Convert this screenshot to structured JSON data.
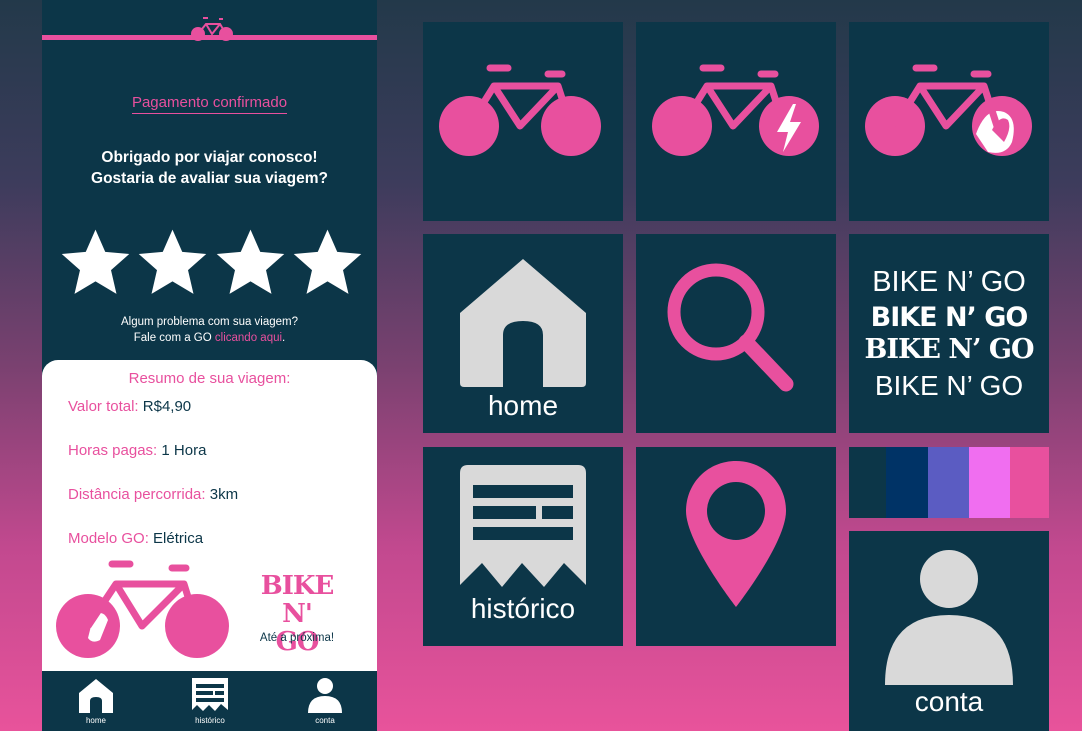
{
  "phone": {
    "payment_title": "Pagamento confirmado",
    "thanks_line1": "Obrigado por viajar conosco!",
    "thanks_line2": "Gostaria de avaliar sua viagem?",
    "rating": 4,
    "problem_line1": "Algum problema com sua viagem?",
    "problem_prefix": "Fale com a GO ",
    "problem_link": "clicando aqui",
    "problem_suffix": ".",
    "summary": {
      "title": "Resumo de sua viagem:",
      "rows": [
        {
          "label": "Valor total:",
          "value": "R$4,90"
        },
        {
          "label": "Horas pagas:",
          "value": "1 Hora"
        },
        {
          "label": "Distância percorrida:",
          "value": "3km"
        },
        {
          "label": "Modelo GO:",
          "value": "Elétrica"
        }
      ],
      "brand_line1": "BIKE N'",
      "brand_line2": "GO",
      "farewell": "Até a próxima!"
    },
    "nav": [
      {
        "label": "home",
        "icon": "home-icon"
      },
      {
        "label": "histórico",
        "icon": "receipt-icon"
      },
      {
        "label": "conta",
        "icon": "user-icon"
      }
    ]
  },
  "tiles": {
    "home_label": "home",
    "history_label": "histórico",
    "account_label": "conta",
    "brand_lines": [
      "BIKE N’ GO",
      "BIKE N’ GO",
      "BIKE N’ GO",
      "BIKE N’ GO"
    ]
  },
  "palette": [
    "#0c3648",
    "#003366",
    "#5b5cc2",
    "#f06ef0",
    "#e8509e"
  ],
  "colors": {
    "accent": "#e8509e",
    "dark": "#0c3648",
    "icon_gray": "#d9d9d9",
    "white": "#ffffff"
  }
}
